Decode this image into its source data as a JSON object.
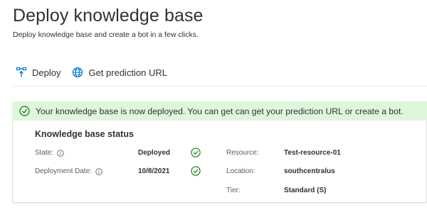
{
  "header": {
    "title": "Deploy knowledge base",
    "subtitle": "Deploy knowledge base and create a bot in a few clicks."
  },
  "toolbar": {
    "deploy_label": "Deploy",
    "prediction_label": "Get prediction URL",
    "deploy_icon": "deploy-icon",
    "prediction_icon": "globe-icon"
  },
  "banner": {
    "icon": "success-check-icon",
    "message": "Your knowledge base is now deployed. You can get can get your prediction URL or create a bot.",
    "background": "#dff6dd",
    "icon_color": "#107c10"
  },
  "status": {
    "title": "Knowledge base status",
    "state_label": "State:",
    "state_value": "Deployed",
    "deployment_date_label": "Deployment Date:",
    "deployment_date_value": "10/8/2021",
    "resource_label": "Resource:",
    "resource_value": "Test-resource-01",
    "location_label": "Location:",
    "location_value": "southcentralus",
    "tier_label": "Tier:",
    "tier_value": "Standard (S)"
  },
  "colors": {
    "accent": "#0078d4",
    "success": "#107c10"
  }
}
